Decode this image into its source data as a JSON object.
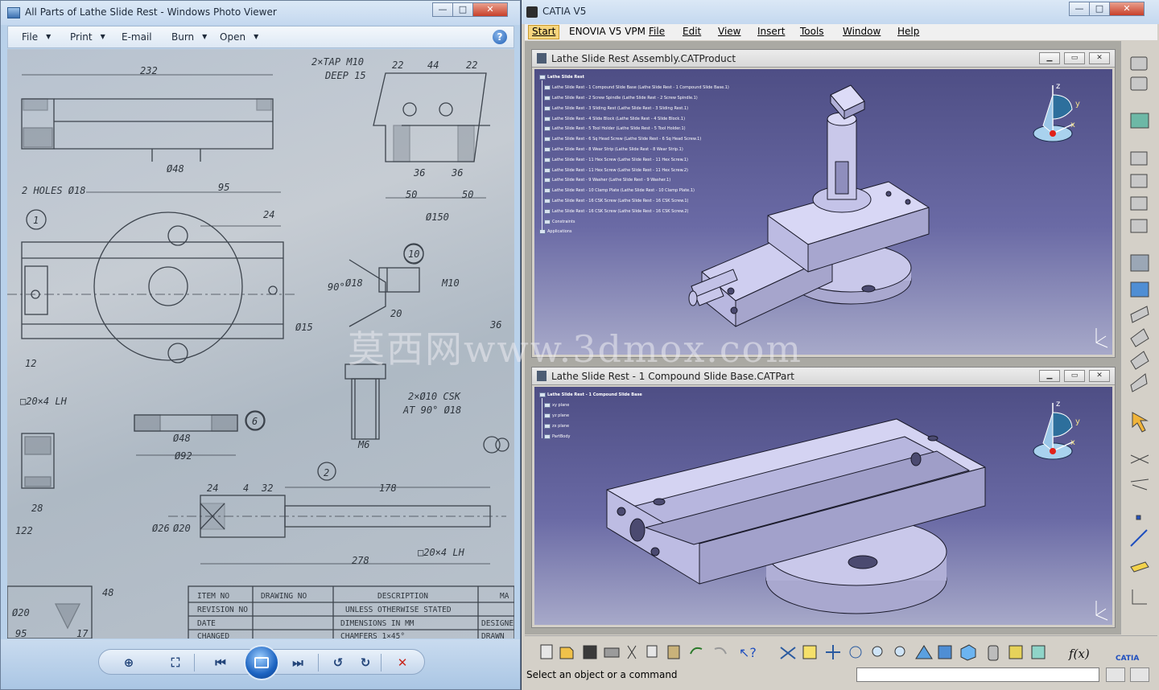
{
  "photo_viewer": {
    "title": "All Parts of Lathe Slide Rest - Windows Photo Viewer",
    "menu": {
      "file": "File",
      "print": "Print",
      "email": "E-mail",
      "burn": "Burn",
      "open": "Open",
      "help": "?"
    },
    "drawing_text": {
      "d232": "232",
      "tap": "2×TAP M10",
      "deep": "DEEP 15",
      "d22a": "22",
      "d44": "44",
      "d22b": "22",
      "d48": "Ø48",
      "d36a": "36",
      "d36b": "36",
      "d50a": "50",
      "d50b": "50",
      "d150": "Ø150",
      "d95": "95",
      "holes": "2 HOLES Ø18",
      "d24": "24",
      "n1": "1",
      "n10": "10",
      "d90": "90°",
      "d18": "Ø18",
      "m10": "M10",
      "d20": "20",
      "d15": "Ø15",
      "d36c": "36",
      "d12": "12",
      "lh1": "□20×4 LH",
      "csk": "2×Ø10 CSK",
      "at90": "AT 90° Ø18",
      "m6": "M6",
      "n6": "6",
      "d48b": "Ø48",
      "d92": "Ø92",
      "n2": "2",
      "d28": "28",
      "d24b": "24",
      "d4": "4",
      "d32": "32",
      "d178": "178",
      "d122": "122",
      "d26": "Ø26",
      "d20b": "Ø20",
      "lh2": "□20×4 LH",
      "d278": "278",
      "d48c": "48",
      "d95b": "95",
      "d17": "17",
      "d20c": "Ø20",
      "item_no": "ITEM NO",
      "drawing_no": "DRAWING NO",
      "description": "DESCRIPTION",
      "revision_no": "REVISION NO",
      "date": "DATE",
      "changed": "CHANGED",
      "unless": "UNLESS OTHERWISE STATED",
      "dimensions": "DIMENSIONS IN MM",
      "chamfers": "CHAMFERS 1×45°",
      "designed": "DESIGNE",
      "drawn": "DRAWN",
      "ma": "MA"
    }
  },
  "catia": {
    "title": "CATIA V5",
    "menu": {
      "start": "Start",
      "enovia": "ENOVIA V5 VPM",
      "file": "File",
      "edit": "Edit",
      "view": "View",
      "insert": "Insert",
      "tools": "Tools",
      "window": "Window",
      "help": "Help"
    },
    "doc1": {
      "title": "Lathe Slide Rest Assembly.CATProduct",
      "tree": [
        "Lathe Slide Rest",
        "Lathe Slide Rest - 1 Compound Slide Base (Lathe Slide Rest - 1 Compound Slide Base.1)",
        "Lathe Slide Rest - 2 Screw Spindle (Lathe Slide Rest - 2 Screw Spindle.1)",
        "Lathe Slide Rest - 3 Sliding Rest (Lathe Slide Rest - 3 Sliding Rest.1)",
        "Lathe Slide Rest - 4 Slide Block (Lathe Slide Rest - 4 Slide Block.1)",
        "Lathe Slide Rest - 5 Tool Holder (Lathe Slide Rest - 5 Tool Holder.1)",
        "Lathe Slide Rest - 6 Sq Head Screw (Lathe Slide Rest - 6 Sq Head Screw.1)",
        "Lathe Slide Rest - 8 Wear Strip (Lathe Slide Rest - 8 Wear Strip.1)",
        "Lathe Slide Rest - 11 Hex Screw (Lathe Slide Rest - 11 Hex Screw.1)",
        "Lathe Slide Rest - 11 Hex Screw (Lathe Slide Rest - 11 Hex Screw.2)",
        "Lathe Slide Rest - 9 Washer (Lathe Slide Rest - 9 Washer.1)",
        "Lathe Slide Rest - 10 Clamp Plate (Lathe Slide Rest - 10 Clamp Plate.1)",
        "Lathe Slide Rest - 16 CSK Screw (Lathe Slide Rest - 16 CSK Screw.1)",
        "Lathe Slide Rest - 16 CSK Screw (Lathe Slide Rest - 16 CSK Screw.2)",
        "Constraints",
        "Applications"
      ]
    },
    "doc2": {
      "title": "Lathe Slide Rest - 1 Compound Slide Base.CATPart",
      "tree": [
        "Lathe Slide Rest - 1 Compound Slide Base",
        "xy plane",
        "yz plane",
        "zx plane",
        "PartBody"
      ]
    },
    "compass": {
      "x": "x",
      "y": "y",
      "z": "z"
    },
    "status": "Select an object or a command",
    "toolbar_labels": {
      "fx": "f(x)",
      "brand": "CATIA"
    }
  },
  "watermark": "莫西网www.3dmox.com",
  "colors": {
    "viewport_top": "#4e4e85",
    "viewport_bottom": "#a7a9c9",
    "part_face": "#c9c8ea",
    "start_highlight": "#f6d57e"
  }
}
